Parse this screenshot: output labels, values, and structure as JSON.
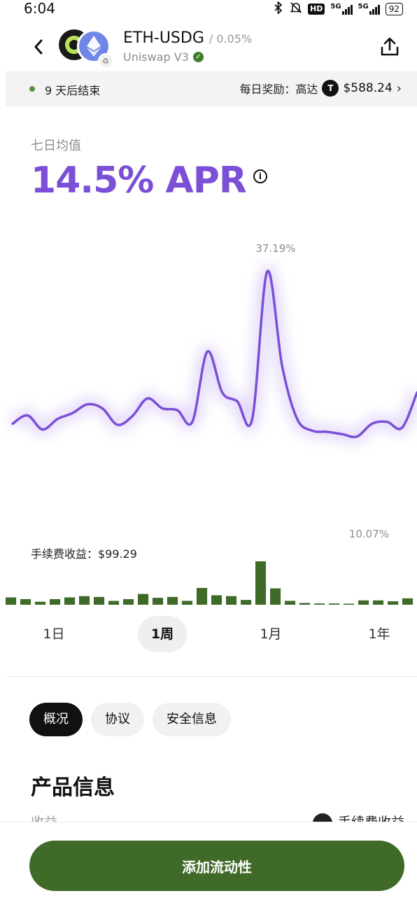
{
  "status_bar": {
    "time": "6:04",
    "icons": [
      "bluetooth-icon",
      "mute-bell-icon",
      "hd-icon",
      "signal-5g-icon",
      "signal-5g-icon",
      "battery-icon"
    ],
    "hd": "HD",
    "net1": "5G",
    "net2": "5G",
    "battery": "92"
  },
  "header": {
    "pair": "ETH-USDG",
    "fee_tier": "/ 0.05%",
    "protocol": "Uniswap V3",
    "back_icon": "chevron-left-icon",
    "share_icon": "share-icon"
  },
  "banner": {
    "status": "9 天后结束",
    "reward_label": "每日奖励：高达",
    "reward_token": "T",
    "reward_amount": "$588.24",
    "chevron": "›"
  },
  "apr": {
    "avg_label": "七日均值",
    "value": "14.5% APR",
    "info": "i"
  },
  "chart_data": [
    {
      "type": "line",
      "series": [
        {
          "values": [
            11.2,
            12.6,
            10.2,
            12.0,
            13.0,
            14.5,
            13.8,
            11.0,
            12.5,
            15.5,
            13.8,
            13.5,
            11.5,
            23.5,
            16.5,
            15.0,
            12.0,
            37.19,
            21.0,
            12.0,
            10.0,
            9.8,
            9.4,
            9.0,
            11.2,
            11.5,
            10.5,
            16.5
          ]
        }
      ],
      "annotations": [
        "37.19%"
      ],
      "color": "#7b4fd6"
    },
    {
      "type": "bar",
      "title": "手续费收益：$99.29",
      "series": [
        {
          "values": [
            1.7,
            1.3,
            0.7,
            1.3,
            1.7,
            2.0,
            1.8,
            0.9,
            1.3,
            2.5,
            1.6,
            1.8,
            0.9,
            3.9,
            2.2,
            2.0,
            1.1,
            10.07,
            3.8,
            0.9,
            0.4,
            0.3,
            0.3,
            0.1,
            1.0,
            1.0,
            0.8,
            1.5
          ]
        }
      ],
      "annotations": [
        "10.07%"
      ],
      "color": "#3f6a28"
    }
  ],
  "range_tabs": [
    {
      "label": "1日",
      "active": false
    },
    {
      "label": "1周",
      "active": true
    },
    {
      "label": "1月",
      "active": false
    },
    {
      "label": "1年",
      "active": false
    }
  ],
  "section_tabs": [
    {
      "label": "概况",
      "active": true
    },
    {
      "label": "协议",
      "active": false
    },
    {
      "label": "安全信息",
      "active": false
    }
  ],
  "product": {
    "title": "产品信息",
    "peek_left": "收益",
    "peek_right": "手续费收益"
  },
  "cta": {
    "label": "添加流动性"
  }
}
